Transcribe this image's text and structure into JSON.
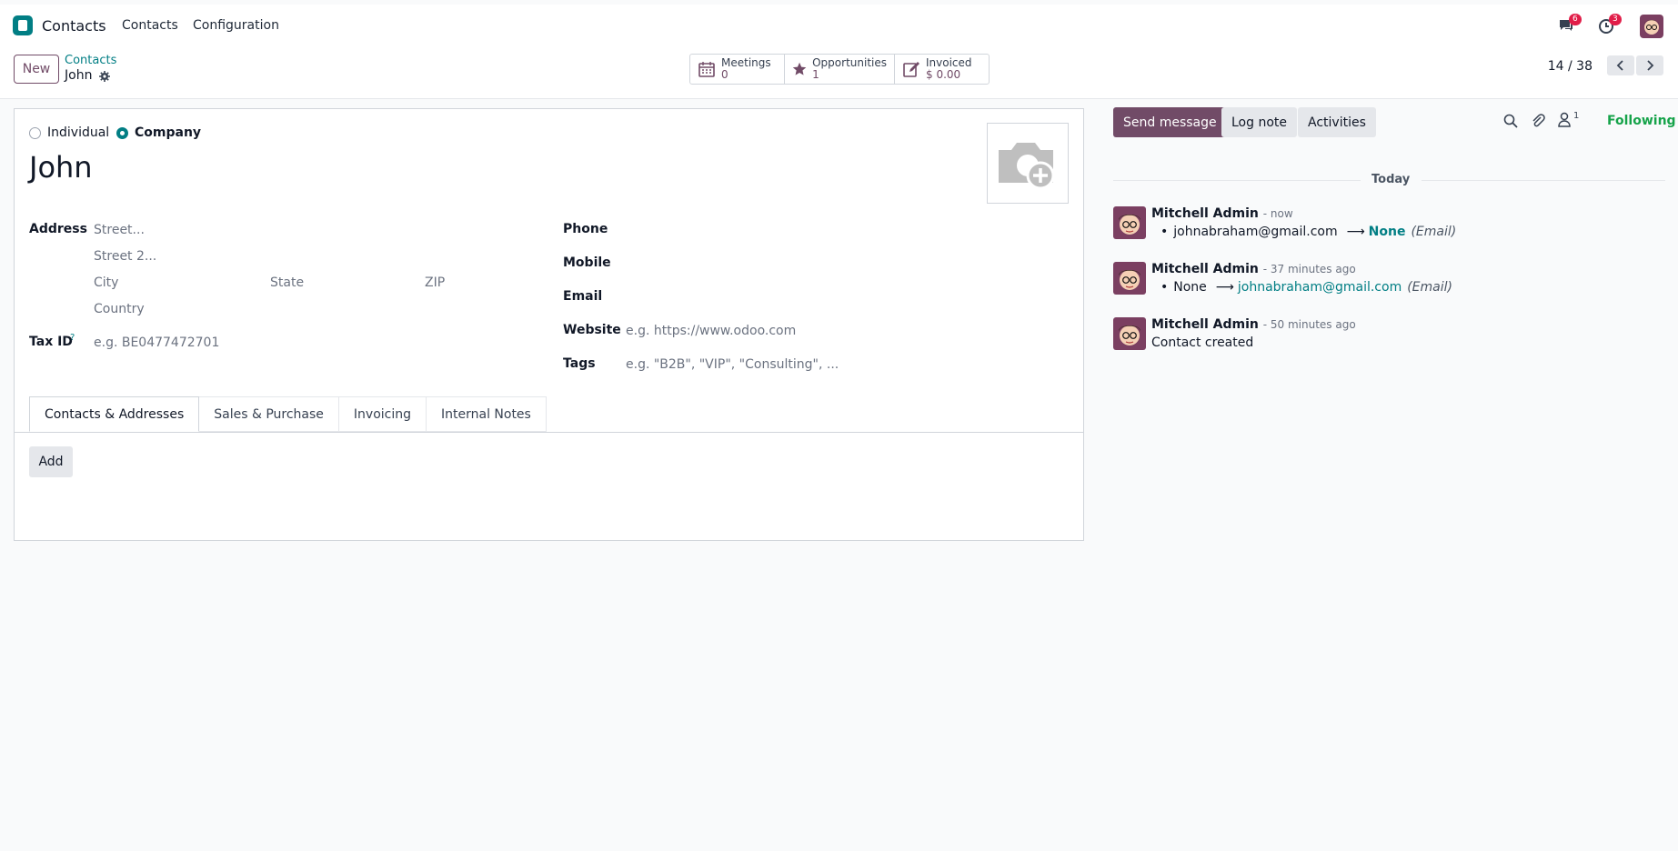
{
  "topbar": {
    "app_title": "Contacts",
    "menu": [
      "Contacts",
      "Configuration"
    ],
    "messages_badge": "6",
    "activities_badge": "3"
  },
  "control": {
    "new_label": "New",
    "breadcrumb_parent": "Contacts",
    "breadcrumb_current": "John",
    "pager": "14 / 38",
    "smart_buttons": [
      {
        "label": "Meetings",
        "value": "0"
      },
      {
        "label": "Opportunities",
        "value": "1"
      },
      {
        "label": "Invoiced",
        "value": "$ 0.00"
      }
    ]
  },
  "form": {
    "type_individual": "Individual",
    "type_company": "Company",
    "name": "John",
    "address_label": "Address",
    "street_ph": "Street...",
    "street2_ph": "Street 2...",
    "city_ph": "City",
    "state_ph": "State",
    "zip_ph": "ZIP",
    "country_ph": "Country",
    "taxid_label": "Tax ID",
    "taxid_help": "?",
    "taxid_ph": "e.g. BE0477472701",
    "phone_label": "Phone",
    "mobile_label": "Mobile",
    "email_label": "Email",
    "website_label": "Website",
    "website_ph": "e.g. https://www.odoo.com",
    "tags_label": "Tags",
    "tags_ph": "e.g. \"B2B\", \"VIP\", \"Consulting\", ...",
    "tabs": [
      "Contacts & Addresses",
      "Sales & Purchase",
      "Invoicing",
      "Internal Notes"
    ],
    "add_label": "Add"
  },
  "chatter": {
    "send_message": "Send message",
    "log_note": "Log note",
    "activities": "Activities",
    "followers_count": "1",
    "following": "Following",
    "today": "Today",
    "messages": [
      {
        "author": "Mitchell Admin",
        "time": "- now",
        "old": "johnabraham@gmail.com",
        "new": "None",
        "field": "(Email)"
      },
      {
        "author": "Mitchell Admin",
        "time": "- 37 minutes ago",
        "old": "None",
        "new": "johnabraham@gmail.com",
        "field": "(Email)"
      },
      {
        "author": "Mitchell Admin",
        "time": "- 50 minutes ago",
        "text": "Contact created"
      }
    ]
  },
  "colors": {
    "brand": "#714b67",
    "teal": "#017e84",
    "following": "#16a34a"
  }
}
